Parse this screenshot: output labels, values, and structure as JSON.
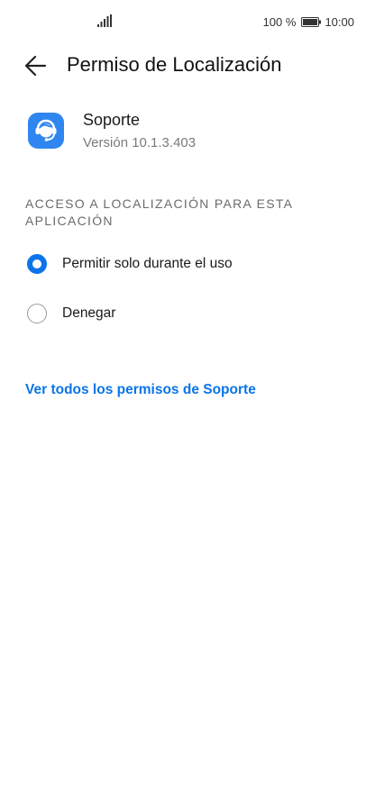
{
  "status_bar": {
    "icons": [
      "signal-icon",
      "battery-icon"
    ],
    "battery": "100 %",
    "time": "10:00"
  },
  "header": {
    "back_icon": "arrow-left-icon",
    "title": "Permiso de Localización"
  },
  "app": {
    "icon": "support-headset-icon",
    "name": "Soporte",
    "version": "Versión 10.1.3.403"
  },
  "section": {
    "title": "ACCESO A LOCALIZACIÓN PARA ESTA APLICACIÓN"
  },
  "options": [
    {
      "label": "Permitir solo durante el uso",
      "selected": true
    },
    {
      "label": "Denegar",
      "selected": false
    }
  ],
  "link": {
    "label": "Ver todos los permisos de Soporte"
  },
  "colors": {
    "accent": "#0a74e8",
    "app_icon": "#2f86f0"
  }
}
